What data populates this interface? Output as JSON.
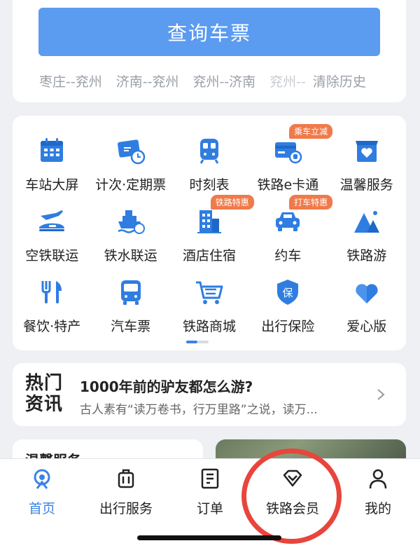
{
  "search": {
    "query_label": "查询车票",
    "history": [
      "枣庄--兖州",
      "济南--兖州",
      "兖州--济南",
      "兖州--"
    ],
    "clear_label": "清除历史"
  },
  "services": {
    "rows": [
      [
        {
          "label": "车站大屏",
          "icon": "station-screen-icon"
        },
        {
          "label": "计次·定期票",
          "icon": "ticket-clock-icon"
        },
        {
          "label": "时刻表",
          "icon": "train-icon"
        },
        {
          "label": "铁路e卡通",
          "icon": "ecard-icon",
          "tag": "乘车立减"
        },
        {
          "label": "温馨服务",
          "icon": "heart-shop-icon"
        }
      ],
      [
        {
          "label": "空铁联运",
          "icon": "plane-train-icon"
        },
        {
          "label": "铁水联运",
          "icon": "ship-train-icon"
        },
        {
          "label": "酒店住宿",
          "icon": "hotel-icon",
          "tag": "铁路特惠"
        },
        {
          "label": "约车",
          "icon": "car-icon",
          "tag": "打车特惠"
        },
        {
          "label": "铁路游",
          "icon": "mountain-icon"
        }
      ],
      [
        {
          "label": "餐饮·特产",
          "icon": "dining-icon"
        },
        {
          "label": "汽车票",
          "icon": "bus-icon"
        },
        {
          "label": "铁路商城",
          "icon": "cart-icon"
        },
        {
          "label": "出行保险",
          "icon": "insurance-shield-icon",
          "glyph": "保"
        },
        {
          "label": "爱心版",
          "icon": "heart-icon"
        }
      ]
    ]
  },
  "news": {
    "badge_line1": "热门",
    "badge_line2": "资讯",
    "title": "1000年前的驴友都怎么游?",
    "subtitle": "古人素有“读万卷书，行万里路”之说，读万..."
  },
  "peek": {
    "left_title": "温馨服务"
  },
  "tabbar": {
    "tabs": [
      {
        "label": "首页",
        "icon": "home-icon",
        "active": true
      },
      {
        "label": "出行服务",
        "icon": "luggage-icon",
        "active": false
      },
      {
        "label": "订单",
        "icon": "order-icon",
        "active": false
      },
      {
        "label": "铁路会员",
        "icon": "diamond-icon",
        "active": false
      },
      {
        "label": "我的",
        "icon": "profile-icon",
        "active": false
      }
    ]
  },
  "colors": {
    "accent": "#3b82e6",
    "button": "#5b9bf0",
    "tag": "#f07a4a",
    "highlight_circle": "#e8453c"
  }
}
